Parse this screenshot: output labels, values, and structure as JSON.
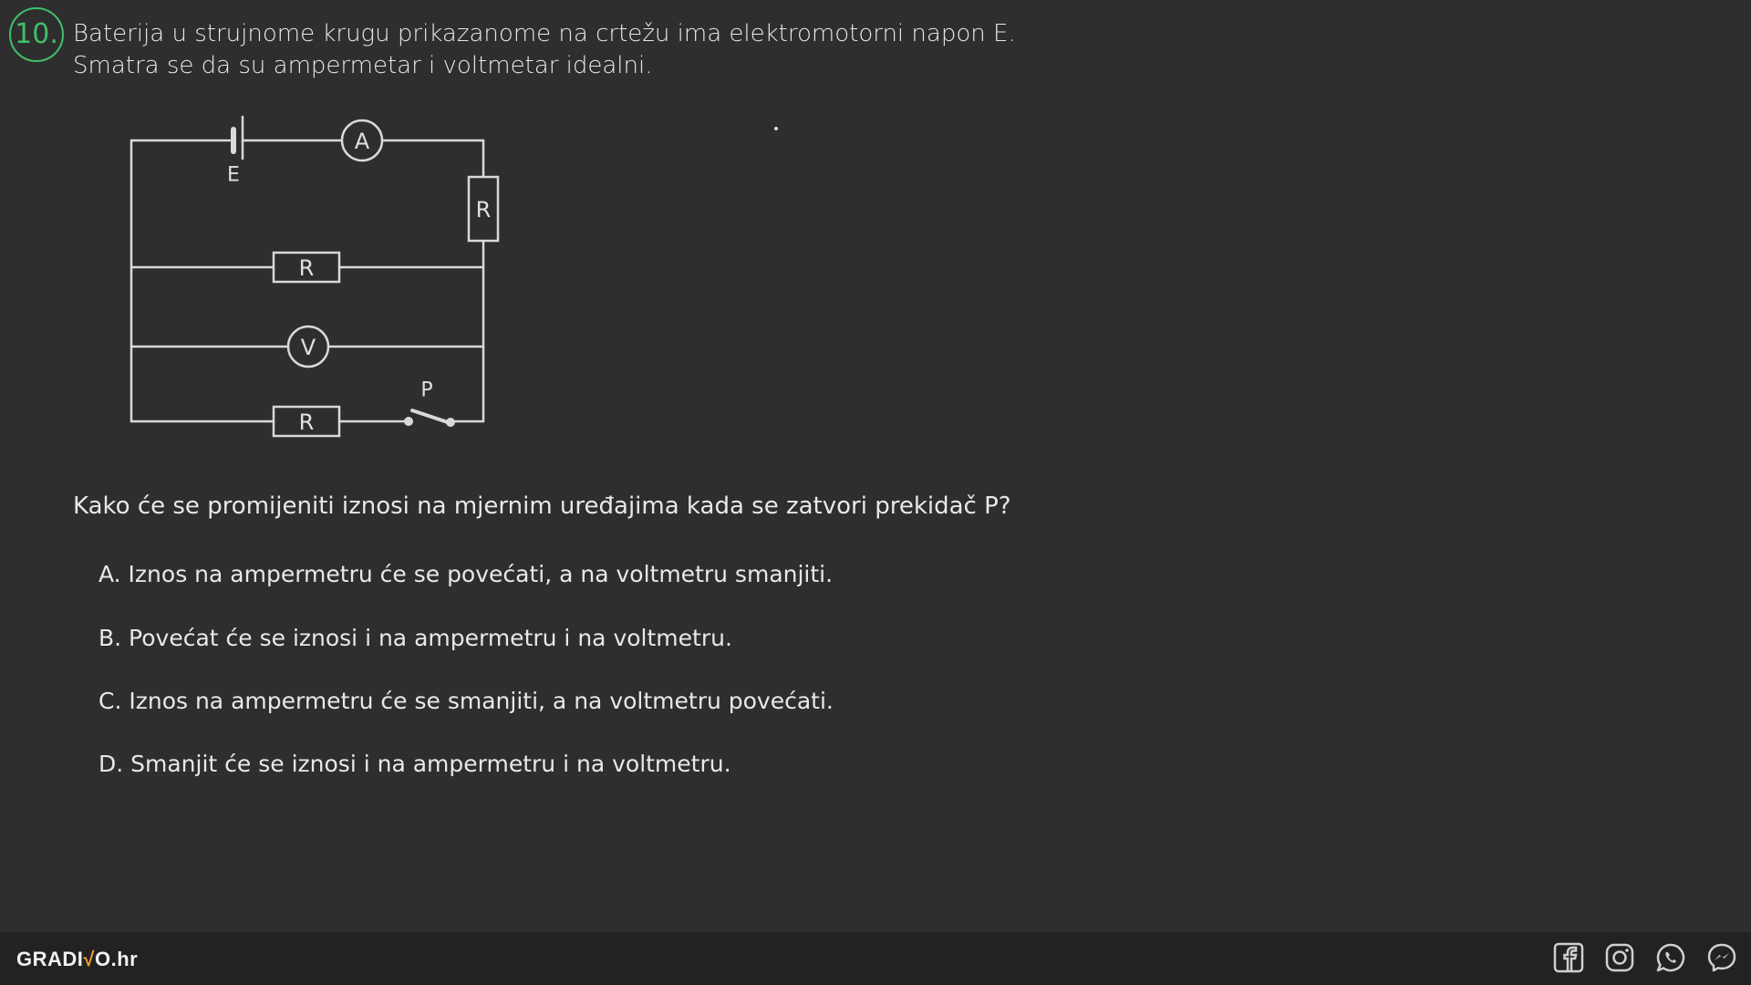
{
  "question": {
    "number": "10.",
    "line1": "Baterija u strujnome krugu prikazanome na crtežu ima elektromotorni napon E.",
    "line2": "Smatra se da su ampermetar i voltmetar idealni.",
    "prompt": "Kako će se promijeniti iznosi na mjernim uređajima kada se zatvori prekidač P?"
  },
  "circuit": {
    "battery_label": "E",
    "ammeter_label": "A",
    "voltmeter_label": "V",
    "resistor_label": "R",
    "switch_label": "P"
  },
  "answers": [
    {
      "text": "A. Iznos na ampermetru će se povećati, a na voltmetru smanjiti."
    },
    {
      "text": "B. Povećat će se iznosi i na ampermetru i na voltmetru."
    },
    {
      "text": "C. Iznos na ampermetru će se smanjiti, a na voltmetru povećati."
    },
    {
      "text": "D. Smanjit će se iznosi i na ampermetru i na voltmetru."
    }
  ],
  "footer": {
    "logo_part1": "GRADI",
    "logo_tick": "√",
    "logo_part2": "O.hr",
    "social_icons": [
      "facebook-icon",
      "instagram-icon",
      "whatsapp-icon",
      "messenger-icon"
    ]
  },
  "colors": {
    "background": "#2e2e2e",
    "chalk": "#e8e8e8",
    "accent_green": "#3fbf6a",
    "footer": "#222222"
  }
}
